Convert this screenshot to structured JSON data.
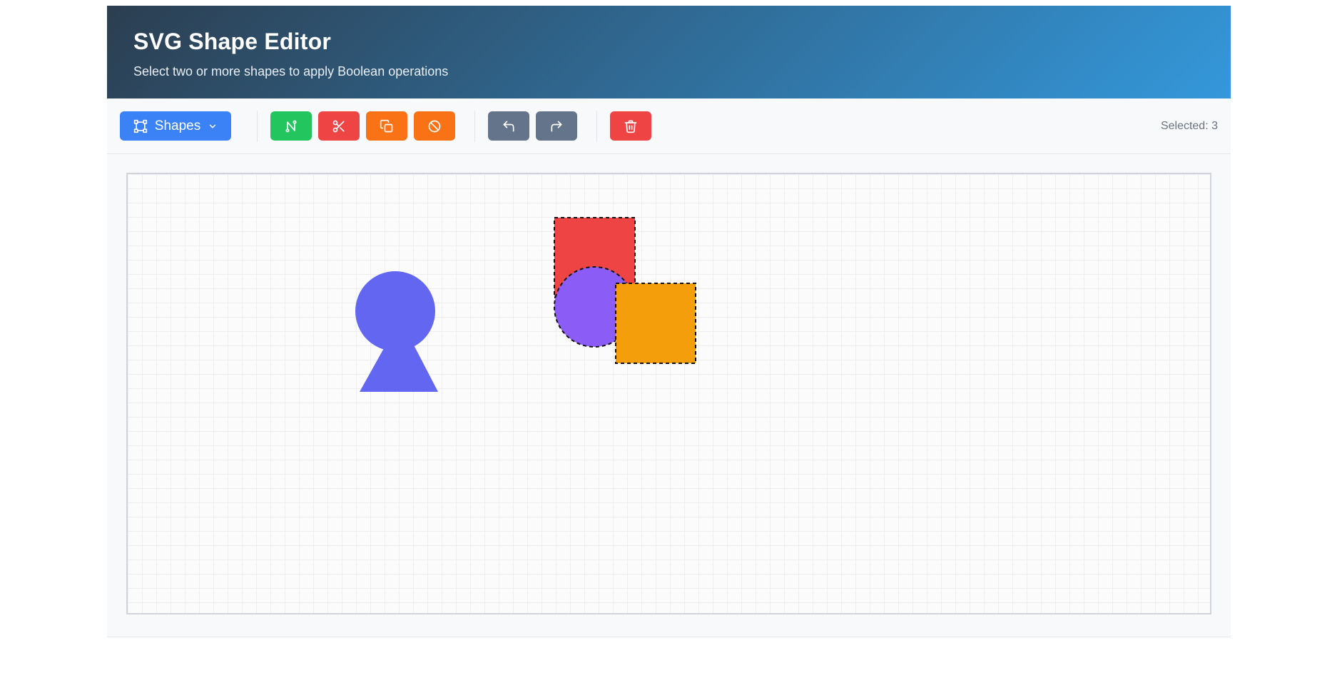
{
  "header": {
    "title": "SVG Shape Editor",
    "subtitle": "Select two or more shapes to apply Boolean operations"
  },
  "toolbar": {
    "shapes_label": "Shapes",
    "shapes_icon": "shape-square-icon",
    "boolean_buttons": [
      {
        "name": "union",
        "icon": "union-path-icon",
        "color": "#22c55e"
      },
      {
        "name": "subtract",
        "icon": "scissors-icon",
        "color": "#ef4444"
      },
      {
        "name": "intersect",
        "icon": "copy-icon",
        "color": "#f97316"
      },
      {
        "name": "exclude",
        "icon": "circle-slash-icon",
        "color": "#f97316"
      }
    ],
    "history_buttons": [
      {
        "name": "undo",
        "icon": "undo-icon",
        "color": "#64748b"
      },
      {
        "name": "redo",
        "icon": "redo-icon",
        "color": "#64748b"
      }
    ],
    "delete_button": {
      "name": "delete",
      "icon": "trash-icon",
      "color": "#ef4444"
    },
    "status": "Selected: 3"
  },
  "canvas": {
    "shapes": [
      {
        "type": "circle",
        "color": "#6366f1",
        "selected": false
      },
      {
        "type": "triangle",
        "color": "#6366f1",
        "selected": false
      },
      {
        "type": "rect",
        "color": "#ef4444",
        "selected": true
      },
      {
        "type": "circle",
        "color": "#8b5cf6",
        "selected": true
      },
      {
        "type": "rect",
        "color": "#f59e0b",
        "selected": true
      }
    ]
  }
}
